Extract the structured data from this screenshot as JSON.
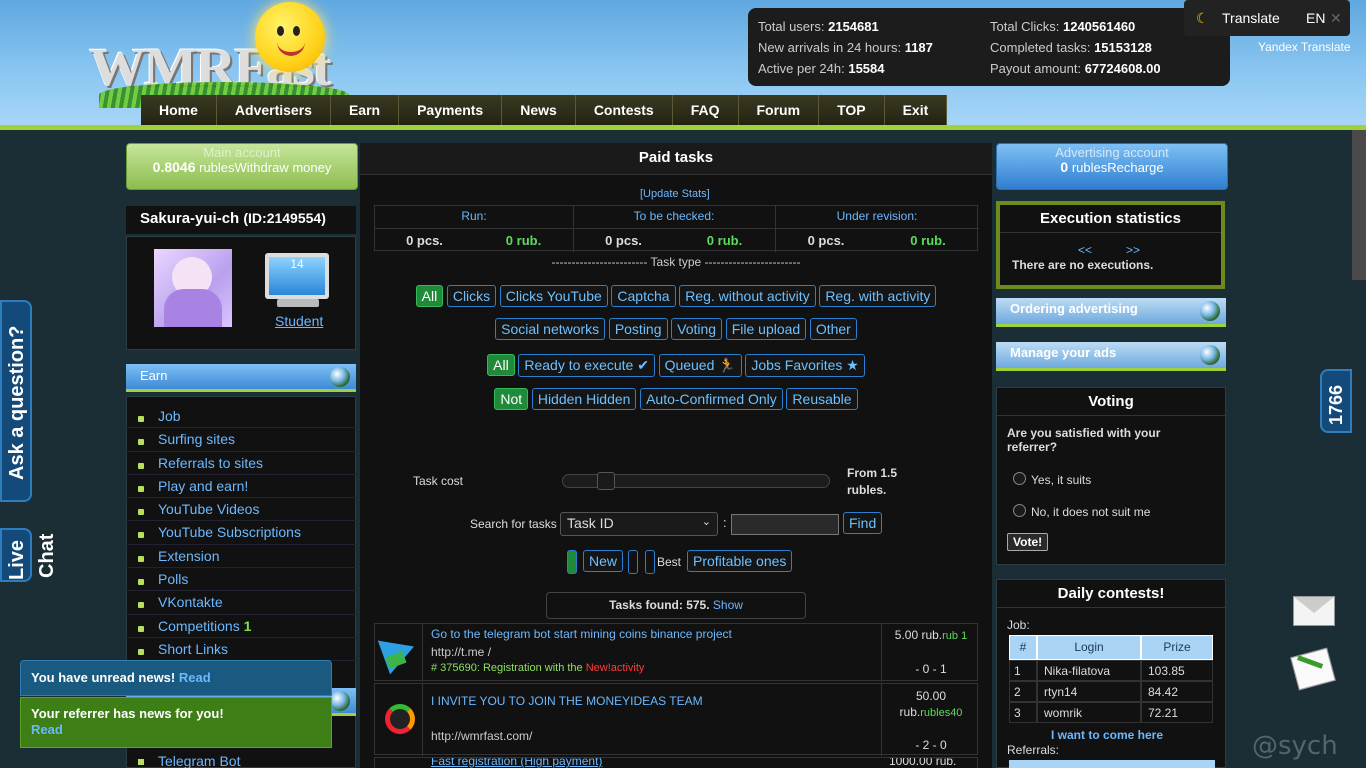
{
  "logo_text": "WMRFast",
  "nav": [
    "Home",
    "Advertisers",
    "Earn",
    "Payments",
    "News",
    "Contests",
    "FAQ",
    "Forum",
    "TOP",
    "Exit"
  ],
  "stats": {
    "total_users_label": "Total users:",
    "total_users": "2154681",
    "new_arrivals_label": "New arrivals in 24 hours:",
    "new_arrivals": "1187",
    "active_label": "Active per 24h:",
    "active": "15584",
    "total_clicks_label": "Total Clicks:",
    "total_clicks": "1240561460",
    "completed_label": "Completed tasks:",
    "completed": "15153128",
    "payout_label": "Payout amount:",
    "payout": "67724608.00"
  },
  "translate": {
    "label": "Translate",
    "lang": "EN",
    "close": "✕",
    "yandex": "Yandex Translate"
  },
  "side": {
    "ask": "Ask a question?",
    "live": "Live",
    "chat": "Chat",
    "counter": "1766"
  },
  "main_account": {
    "title": "Main account",
    "amount": "0.8046",
    "unit": "rubles",
    "withdraw": "Withdraw money"
  },
  "user": {
    "name": "Sakura-yui-ch",
    "id": "(ID:2149554)",
    "level": "14",
    "status": "Student"
  },
  "earn": {
    "title": "Earn",
    "items": [
      "Job",
      "Surfing sites",
      "Referrals to sites",
      "Play and earn!",
      "YouTube Videos",
      "YouTube Subscriptions",
      "Extension",
      "Polls",
      "VKontakte",
      "Competitions",
      "Short Links"
    ],
    "competitions_badge": "1",
    "telegram": "Telegram Bot"
  },
  "notices": {
    "news": "You have unread news!",
    "news_read": "Read",
    "ref": "Your referrer has news for you!",
    "ref_read": "Read"
  },
  "center": {
    "title": "Paid tasks",
    "update": "[Update Stats]",
    "col_run": "Run:",
    "col_check": "To be checked:",
    "col_revision": "Under revision:",
    "run_pcs": "0 pcs.",
    "run_rub": "0 rub.",
    "check_pcs": "0 pcs.",
    "check_rub": "0 rub.",
    "rev_pcs": "0 pcs.",
    "rev_rub": "0 rub.",
    "task_type": "------------------------ Task type ------------------------",
    "types1": [
      "All",
      "Clicks",
      "Clicks YouTube",
      "Captcha",
      "Reg. without activity",
      "Reg. with activity"
    ],
    "types2": [
      "Social networks",
      "Posting",
      "Voting",
      "File upload",
      "Other"
    ],
    "filters": [
      "All",
      "Ready to execute ✔",
      "Queued 🏃",
      "Jobs Favorites ★"
    ],
    "filters2": [
      "Not",
      "Hidden Hidden",
      "Auto-Confirmed Only",
      "Reusable"
    ],
    "cost_label": "Task cost",
    "cost_value": "From 1.5 rubles.",
    "cost_slider_fraction": 0.05,
    "search_label": "Search for tasks",
    "search_select": "Task ID",
    "search_colon": ":",
    "search_find": "Find",
    "sort_new": "New",
    "sort_best": "Best",
    "sort_profitable": "Profitable ones",
    "found_label": "Tasks found:",
    "found_count": "575.",
    "found_show": "Show",
    "tasks": [
      {
        "title": "Go to the telegram bot start mining coins binance project",
        "url": "http://t.me /",
        "meta_prefix": "# 375690: Registration with the",
        "meta_new": "New!",
        "meta_suffix": "activity",
        "price": "5.00 rub.",
        "bonus": "rub 1",
        "counts": "- 0 - 1"
      },
      {
        "title": "I INVITE YOU TO JOIN THE MONEYIDEAS TEAM",
        "url": "http://wmrfast.com/",
        "price": "50.00 rub.",
        "bonus": "rubles40",
        "counts": "- 2 - 0"
      },
      {
        "title": "Fast registration (High payment)",
        "price": "1000.00 rub."
      }
    ]
  },
  "right": {
    "adv_title": "Advertising account",
    "adv_amount": "0",
    "adv_unit": "rubles",
    "adv_recharge": "Recharge",
    "exec_title": "Execution statistics",
    "exec_prev": "<<",
    "exec_next": ">>",
    "exec_empty": "There are no executions.",
    "ordering": "Ordering advertising",
    "manage": "Manage your ads",
    "voting_title": "Voting",
    "voting_q": "Are you satisfied with your referrer?",
    "vote_yes": "Yes, it suits",
    "vote_no": "No, it does not suit me",
    "vote_btn": "Vote!",
    "contests_title": "Daily contests!",
    "job_label": "Job:",
    "table_head": [
      "#",
      "Login",
      "Prize"
    ],
    "table_rows": [
      [
        "1",
        "Nika-filatova",
        "103.85"
      ],
      [
        "2",
        "rtyn14",
        "84.42"
      ],
      [
        "3",
        "womrik",
        "72.21"
      ]
    ],
    "want": "I want to come here",
    "referrals": "Referrals:"
  },
  "watermark": "@sych"
}
